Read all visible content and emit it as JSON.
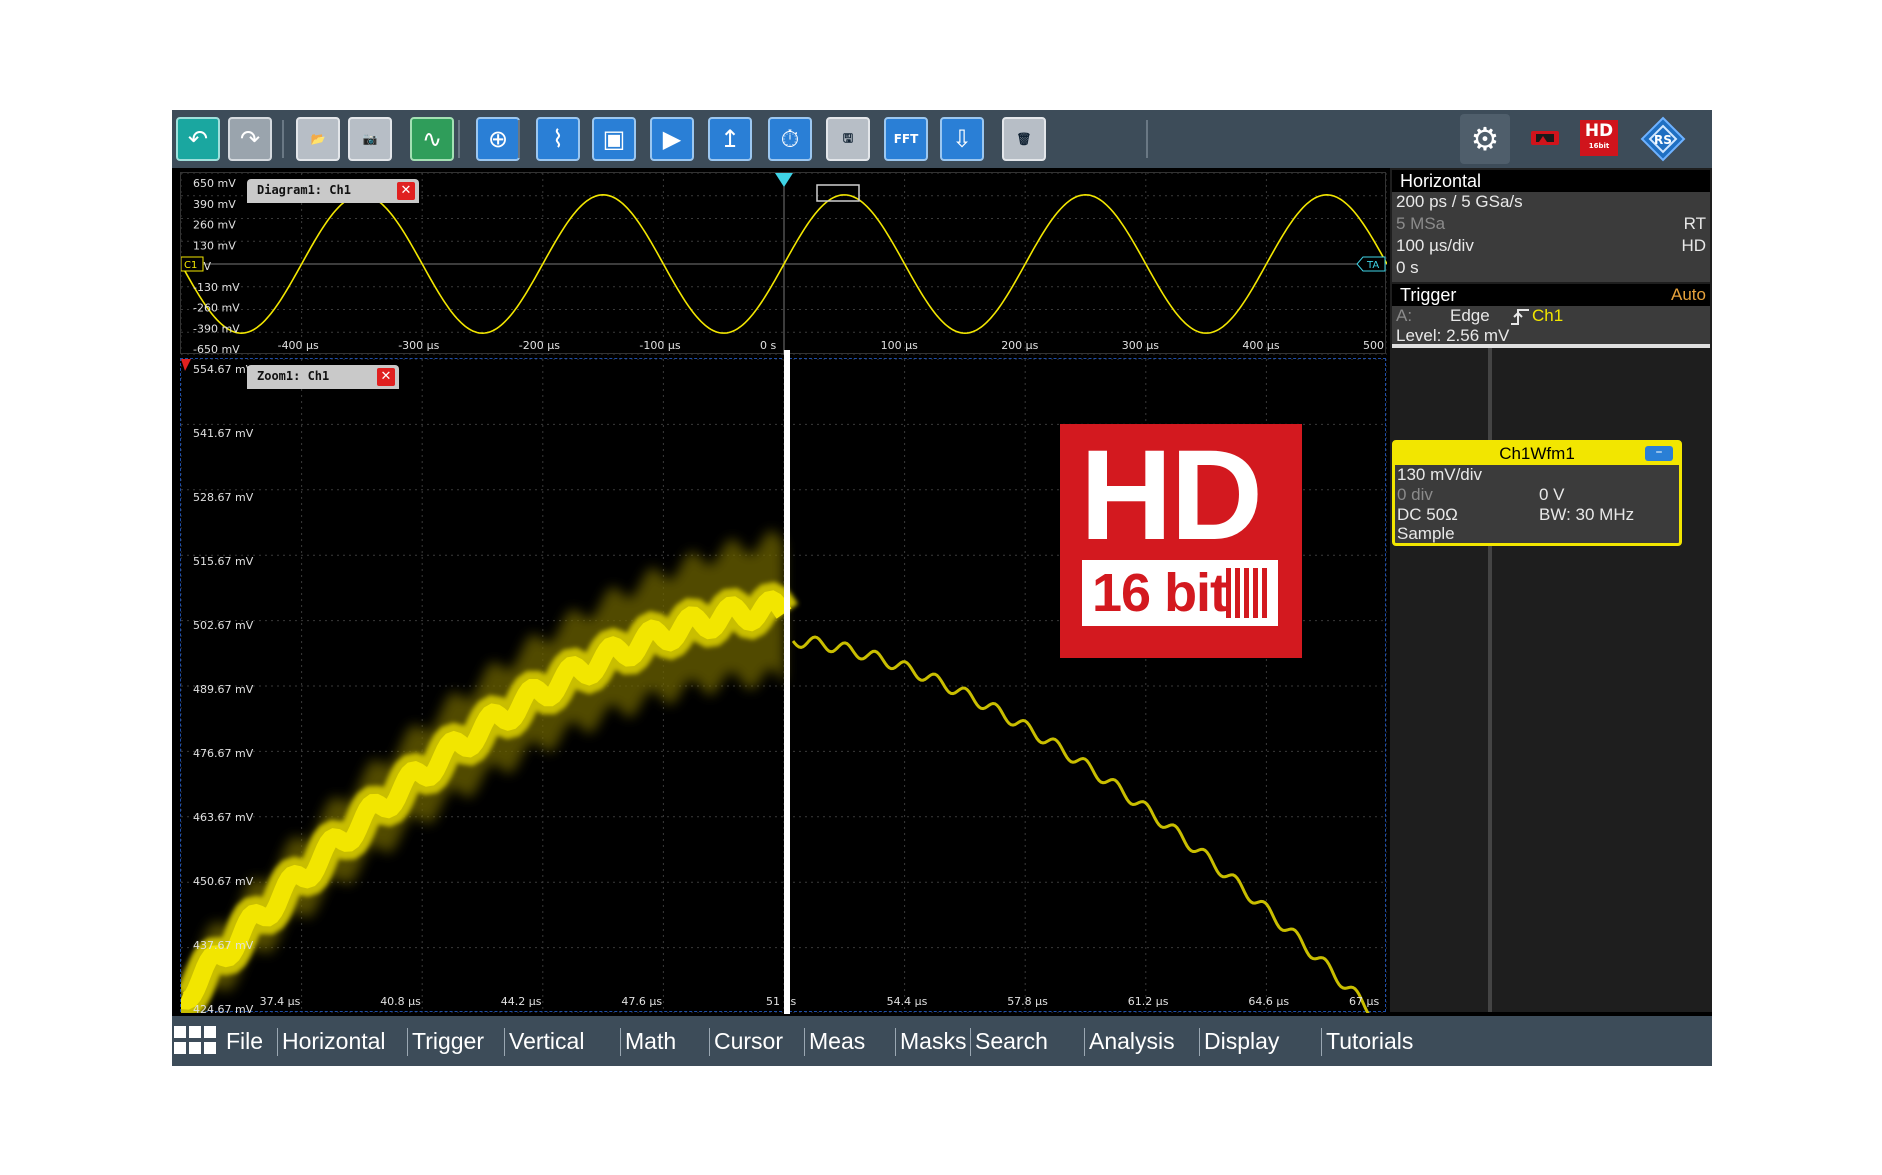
{
  "toolbar": {
    "buttons": [
      {
        "name": "undo-button",
        "icon": "undo-icon",
        "glyph": "↶",
        "style": "teal"
      },
      {
        "name": "redo-button",
        "icon": "redo-icon",
        "glyph": "↷",
        "style": "gray"
      },
      {
        "name": "open-button",
        "icon": "folder-icon",
        "glyph": "📂",
        "style": "grey2"
      },
      {
        "name": "screenshot-button",
        "icon": "camera-icon",
        "glyph": "📷",
        "style": "grey2"
      },
      {
        "name": "autoset-button",
        "icon": "autoset-icon",
        "glyph": "∿",
        "style": "green"
      },
      {
        "name": "zoom-button",
        "icon": "magnifier-icon",
        "glyph": "⊕",
        "style": "blue"
      },
      {
        "name": "measure-button",
        "icon": "measure-icon",
        "glyph": "⌇",
        "style": "blue"
      },
      {
        "name": "mask-button",
        "icon": "mask-icon",
        "glyph": "▣",
        "style": "blue"
      },
      {
        "name": "cursor-button",
        "icon": "cursor-icon",
        "glyph": "▶",
        "style": "blue"
      },
      {
        "name": "marker-button",
        "icon": "marker-icon",
        "glyph": "↥",
        "style": "blue"
      },
      {
        "name": "history-button",
        "icon": "history-icon",
        "glyph": "⏱",
        "style": "blue"
      },
      {
        "name": "save-button",
        "icon": "save-icon",
        "glyph": "🖫",
        "style": "grey2"
      },
      {
        "name": "fft-button",
        "icon": "fft-icon",
        "glyph": "FFT",
        "style": "blue"
      },
      {
        "name": "probe-button",
        "icon": "probe-icon",
        "glyph": "⇩",
        "style": "blue"
      },
      {
        "name": "delete-button",
        "icon": "trash-icon",
        "glyph": "🗑",
        "style": "grey2"
      }
    ],
    "hd_small": "HD",
    "hd_small_sub": "16bit"
  },
  "diagram": {
    "tab_label": "Diagram1: Ch1",
    "y_labels": [
      "650 mV",
      "390 mV",
      "260 mV",
      "130 mV",
      "0 V",
      "-130 mV",
      "-260 mV",
      "-390 mV",
      "-650 mV"
    ],
    "x_labels": [
      "-400 µs",
      "-300 µs",
      "-200 µs",
      "-100 µs",
      "0 s",
      "100 µs",
      "200 µs",
      "300 µs",
      "400 µs",
      "500 µs"
    ],
    "channel_marker": "C1",
    "trigger_marker": "TA"
  },
  "zoom": {
    "tab_label": "Zoom1: Ch1",
    "y_labels": [
      "554.67 mV",
      "541.67 mV",
      "528.67 mV",
      "515.67 mV",
      "502.67 mV",
      "489.67 mV",
      "476.67 mV",
      "463.67 mV",
      "450.67 mV",
      "437.67 mV",
      "424.67 mV"
    ],
    "x_labels": [
      "37.4 µs",
      "40.8 µs",
      "44.2 µs",
      "47.6 µs",
      "51 µs",
      "54.4 µs",
      "57.8 µs",
      "61.2 µs",
      "64.6 µs",
      "67 µs"
    ]
  },
  "hd_badge": {
    "big": "HD",
    "small": "16 bit"
  },
  "horizontal": {
    "title": "Horizontal",
    "line1": "200 ps / 5 GSa/s",
    "line2": "5 MSa",
    "line2_right": "RT",
    "line3": "100 µs/div",
    "line3_right": "HD",
    "line4": "0 s"
  },
  "trigger": {
    "title": "Trigger",
    "mode": "Auto",
    "source_prefix": "A:",
    "type": "Edge",
    "channel": "Ch1",
    "level": "Level: 2.56 mV"
  },
  "waveform": {
    "title": "Ch1Wfm1",
    "minimize": "–",
    "scale": "130 mV/div",
    "offset_div": "0 div",
    "offset_v": "0 V",
    "coupling": "DC 50Ω",
    "bandwidth": "BW: 30 MHz",
    "mode": "Sample"
  },
  "menu": [
    "File",
    "Horizontal",
    "Trigger",
    "Vertical",
    "Math",
    "Cursor",
    "Meas",
    "Masks",
    "Search",
    "Analysis",
    "Display",
    "Tutorials"
  ],
  "colors": {
    "trace": "#f2e600",
    "accent": "#2a7fd6",
    "hd_red": "#d3191f"
  }
}
